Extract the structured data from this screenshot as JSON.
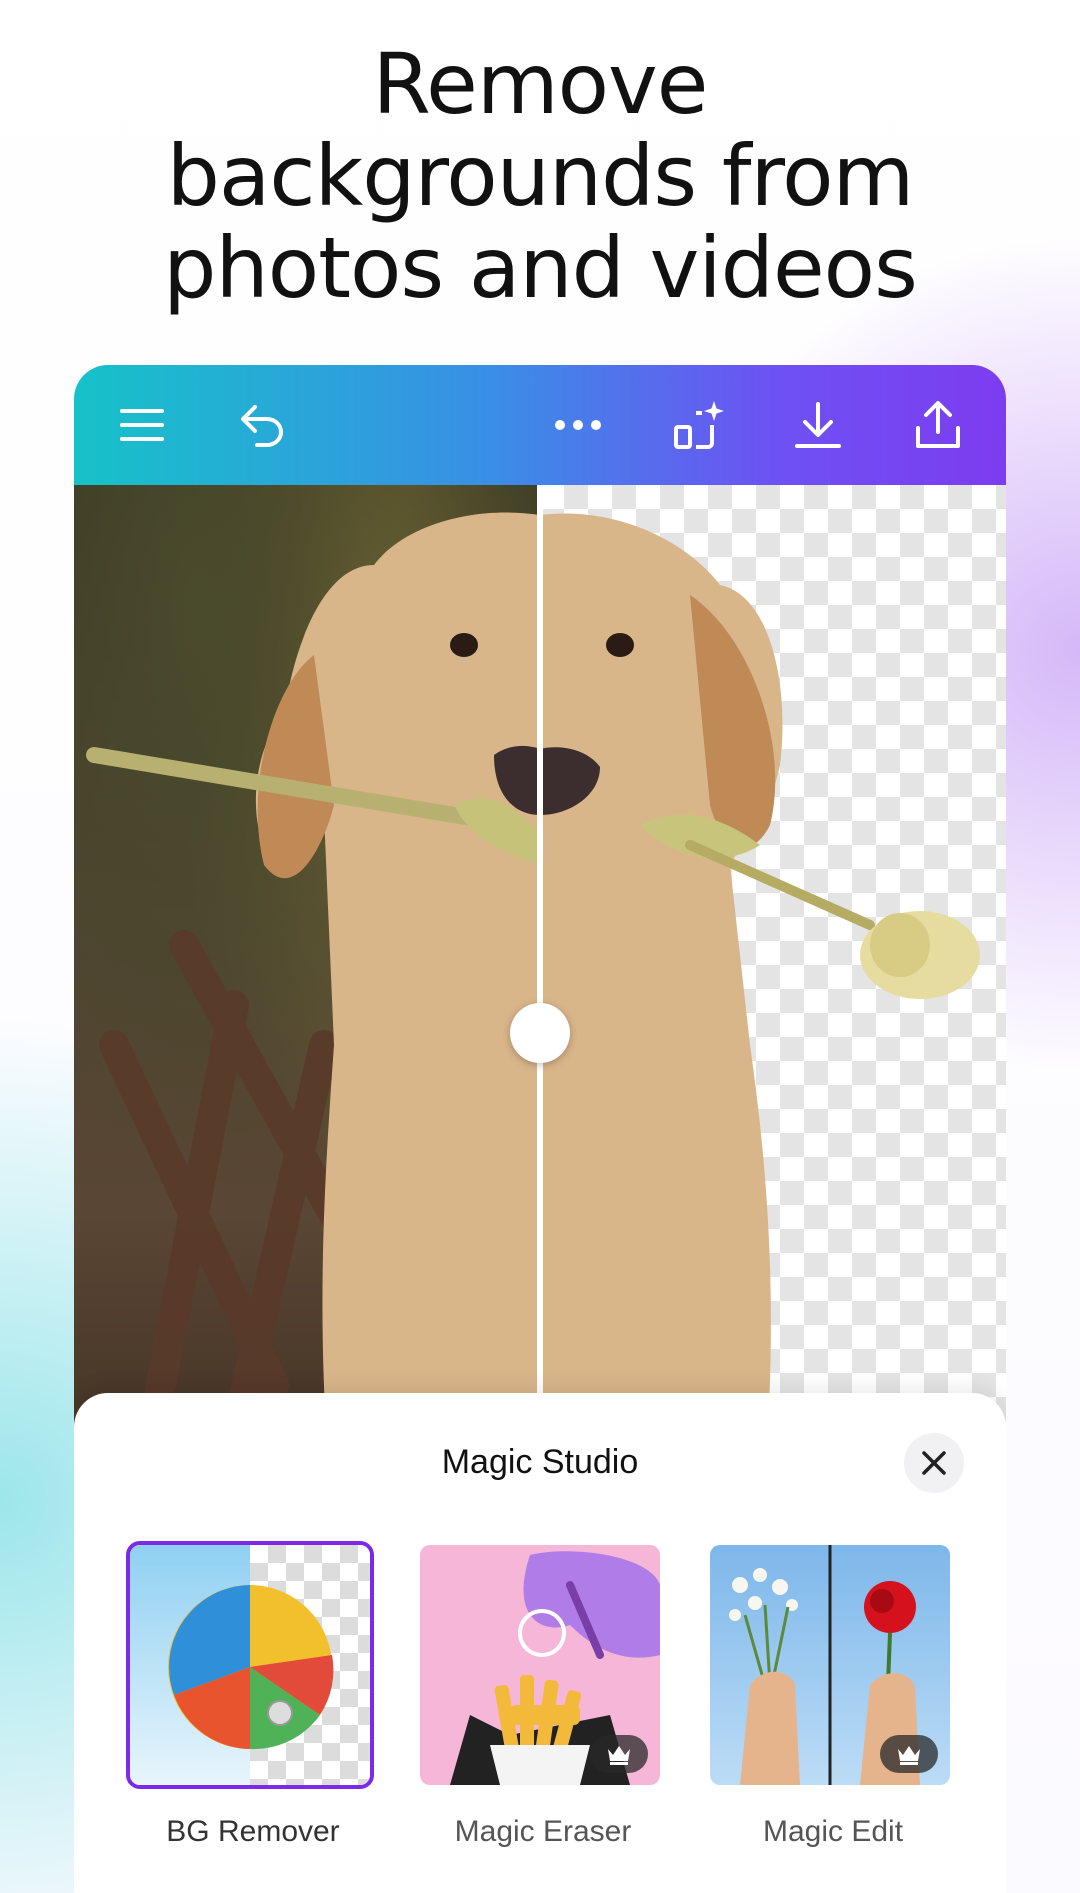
{
  "headline": {
    "line1": "Remove",
    "line2": "backgrounds from",
    "line3": "photos and videos"
  },
  "toolbar": {
    "icons": [
      "menu-icon",
      "undo-icon",
      "more-icon",
      "magic-resize-icon",
      "download-icon",
      "share-icon"
    ],
    "gradient": [
      "#16c2c9",
      "#7d3cf0"
    ]
  },
  "preview": {
    "subject": "golden retriever puppy holding a tulip",
    "comparison_slider_position": 0.5
  },
  "sheet": {
    "title": "Magic Studio",
    "tools": [
      {
        "label": "BG Remover",
        "selected": true,
        "premium": false
      },
      {
        "label": "Magic Eraser",
        "selected": false,
        "premium": true
      },
      {
        "label": "Magic Edit",
        "selected": false,
        "premium": true
      }
    ]
  },
  "colors": {
    "accent": "#7d2ae8",
    "text": "#111111"
  }
}
